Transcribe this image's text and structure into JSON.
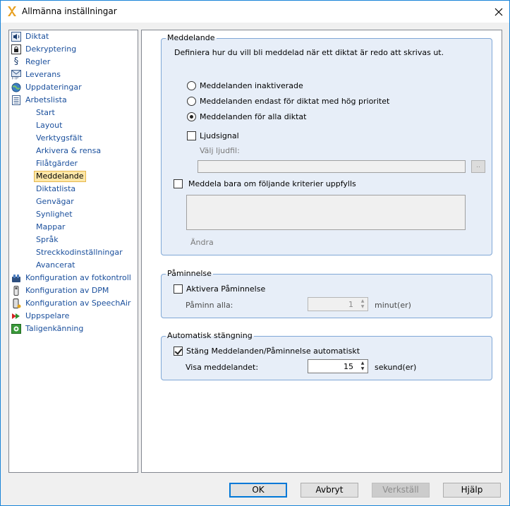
{
  "window": {
    "title": "Allmänna inställningar"
  },
  "tree": {
    "top_items": [
      {
        "label": "Diktat"
      },
      {
        "label": "Dekryptering"
      },
      {
        "label": "Regler"
      },
      {
        "label": "Leverans"
      },
      {
        "label": "Uppdateringar"
      },
      {
        "label": "Arbetslista"
      }
    ],
    "sub_items": [
      {
        "label": "Start"
      },
      {
        "label": "Layout"
      },
      {
        "label": "Verktygsfält"
      },
      {
        "label": "Arkivera & rensa"
      },
      {
        "label": "Filåtgärder"
      },
      {
        "label": "Meddelande",
        "selected": true
      },
      {
        "label": "Diktatlista"
      },
      {
        "label": "Genvägar"
      },
      {
        "label": "Synlighet"
      },
      {
        "label": "Mappar"
      },
      {
        "label": "Språk"
      },
      {
        "label": "Streckkodinställningar"
      },
      {
        "label": "Avancerat"
      }
    ],
    "bottom_items": [
      {
        "label": "Konfiguration av fotkontroll"
      },
      {
        "label": "Konfiguration av DPM"
      },
      {
        "label": "Konfiguration av SpeechAir"
      },
      {
        "label": "Uppspelare"
      },
      {
        "label": "Taligenkänning"
      }
    ]
  },
  "meddelande": {
    "legend": "Meddelande",
    "description": "Definiera hur du vill bli meddelad när ett diktat är redo att skrivas ut.",
    "options": [
      {
        "label": "Meddelanden inaktiverade",
        "checked": false
      },
      {
        "label": "Meddelanden endast för diktat med hög prioritet",
        "checked": false
      },
      {
        "label": "Meddelanden för alla diktat",
        "checked": true
      }
    ],
    "sound_label": "Ljudsignal",
    "sound_checked": false,
    "sound_file_label": "Välj ljudfil:",
    "sound_file_value": "",
    "browse_label": "..",
    "criteria_label": "Meddela bara om följande kriterier uppfylls",
    "criteria_checked": false,
    "change_label": "Ändra"
  },
  "paminnelse": {
    "legend": "Påminnelse",
    "enable_label": "Aktivera Påminnelse",
    "enable_checked": false,
    "interval_label": "Påminn alla:",
    "interval_value": "1",
    "interval_unit": "minut(er)"
  },
  "autoclose": {
    "legend": "Automatisk stängning",
    "enable_label": "Stäng Meddelanden/Påminnelse automatiskt",
    "enable_checked": true,
    "show_label": "Visa meddelandet:",
    "show_value": "15",
    "show_unit": "sekund(er)"
  },
  "buttons": {
    "ok": "OK",
    "cancel": "Avbryt",
    "apply": "Verkställ",
    "help": "Hjälp"
  },
  "colors": {
    "accent": "#0078d7",
    "group_bg": "#e7eef8",
    "group_border": "#7fa7d6",
    "selection": "#fde7a8"
  }
}
